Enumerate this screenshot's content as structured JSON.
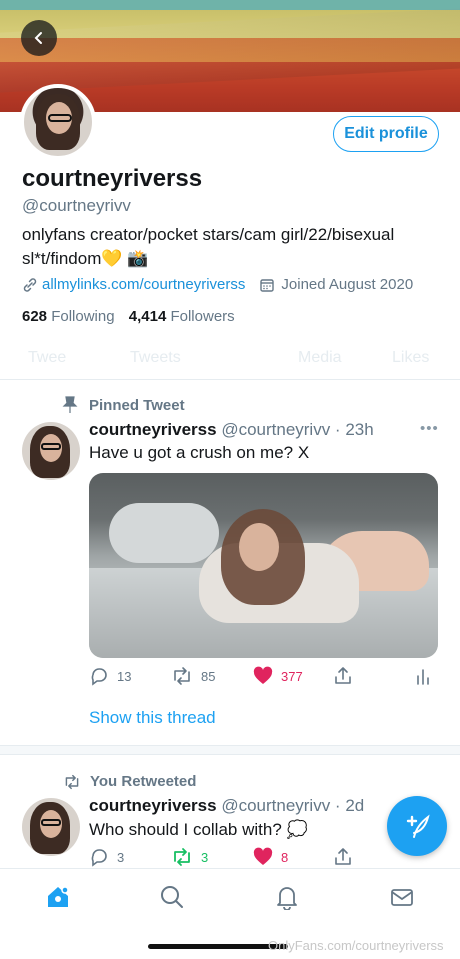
{
  "profile": {
    "display_name": "courtneyriverss",
    "handle": "@courtneyrivv",
    "bio": "onlyfans creator/pocket stars/cam girl/22/bisexual sl*t/findom💛 📸",
    "link": "allmylinks.com/courtneyriverss",
    "joined": "Joined August 2020",
    "following_count": "628",
    "following_label": "Following",
    "followers_count": "4,414",
    "followers_label": "Followers",
    "edit_label": "Edit profile"
  },
  "tabs": [
    "Twee",
    "Tweets",
    "Media",
    "Likes"
  ],
  "pinned_tweet": {
    "label": "Pinned Tweet",
    "author": "courtneyriverss",
    "handle_time": "@courtneyrivv · 23h",
    "text": "Have u got a crush on me? X",
    "replies": "13",
    "retweets": "85",
    "likes": "377",
    "show_thread": "Show this thread"
  },
  "retweet": {
    "label": "You Retweeted",
    "author": "courtneyriverss",
    "handle_time": "@courtneyrivv · 2d",
    "text": "Who should I collab with? 💭",
    "replies": "3",
    "retweets": "3",
    "likes": "8"
  },
  "watermark": "OnlyFans.com/courtneyriverss",
  "colors": {
    "accent": "#1da1f2",
    "like": "#e0245e",
    "retweet_active": "#17bf63"
  }
}
